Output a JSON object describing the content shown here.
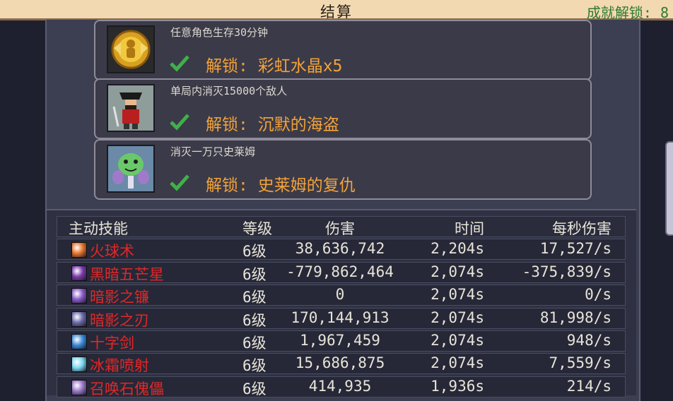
{
  "header": {
    "title": "结算",
    "achievement_count": "成就解锁: 8"
  },
  "achievements": [
    {
      "desc": "任意角色生存30分钟",
      "unlock": "解锁: 彩虹水晶x5",
      "icon": "gold-angel-medal-icon"
    },
    {
      "desc": "单局内消灭15000个敌人",
      "unlock": "解锁: 沉默的海盗",
      "icon": "pirate-character-icon"
    },
    {
      "desc": "消灭一万只史莱姆",
      "unlock": "解锁: 史莱姆的复仇",
      "icon": "slime-monster-icon"
    }
  ],
  "stats": {
    "headers": {
      "name": "主动技能",
      "level": "等级",
      "damage": "伤害",
      "time": "时间",
      "dps": "每秒伤害"
    },
    "rows": [
      {
        "name": "火球术",
        "level": "6级",
        "damage": "38,636,742",
        "time": "2,204s",
        "dps": "17,527/s",
        "icon": "fireball-icon",
        "color": "#e8742a"
      },
      {
        "name": "黑暗五芒星",
        "level": "6级",
        "damage": "-779,862,464",
        "time": "2,074s",
        "dps": "-375,839/s",
        "icon": "dark-pentagram-icon",
        "color": "#7a3aa8"
      },
      {
        "name": "暗影之镰",
        "level": "6级",
        "damage": "0",
        "time": "2,074s",
        "dps": "0/s",
        "icon": "shadow-scythe-icon",
        "color": "#8a5ac8"
      },
      {
        "name": "暗影之刃",
        "level": "6级",
        "damage": "170,144,913",
        "time": "2,074s",
        "dps": "81,998/s",
        "icon": "shadow-blade-icon",
        "color": "#6a6aa8"
      },
      {
        "name": "十字剑",
        "level": "6级",
        "damage": "1,967,459",
        "time": "2,074s",
        "dps": "948/s",
        "icon": "cross-sword-icon",
        "color": "#3a8ad8"
      },
      {
        "name": "冰霜喷射",
        "level": "6级",
        "damage": "15,686,875",
        "time": "2,074s",
        "dps": "7,559/s",
        "icon": "frost-spray-icon",
        "color": "#7ad8f0"
      },
      {
        "name": "召唤石傀儡",
        "level": "6级",
        "damage": "414,935",
        "time": "1,936s",
        "dps": "214/s",
        "icon": "summon-golem-icon",
        "color": "#9a78c8"
      }
    ]
  }
}
